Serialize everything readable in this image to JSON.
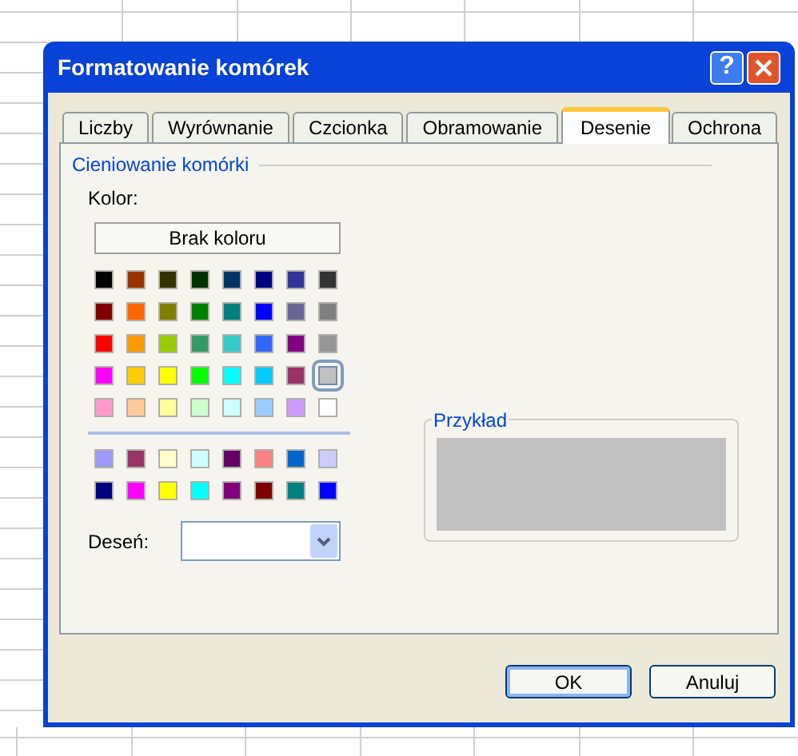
{
  "window": {
    "title": "Formatowanie komórek",
    "help_button": "?"
  },
  "tabs": [
    {
      "label": "Liczby",
      "selected": false
    },
    {
      "label": "Wyrównanie",
      "selected": false
    },
    {
      "label": "Czcionka",
      "selected": false
    },
    {
      "label": "Obramowanie",
      "selected": false
    },
    {
      "label": "Desenie",
      "selected": true
    },
    {
      "label": "Ochrona",
      "selected": false
    }
  ],
  "shading": {
    "title": "Cieniowanie komórki",
    "color_label": "Kolor:",
    "no_color_button": "Brak koloru",
    "palette": [
      [
        {
          "color": "#000000",
          "selected": false
        },
        {
          "color": "#993300",
          "selected": false
        },
        {
          "color": "#333300",
          "selected": false
        },
        {
          "color": "#003300",
          "selected": false
        },
        {
          "color": "#003366",
          "selected": false
        },
        {
          "color": "#000080",
          "selected": false
        },
        {
          "color": "#333399",
          "selected": false
        },
        {
          "color": "#333333",
          "selected": false
        }
      ],
      [
        {
          "color": "#800000",
          "selected": false
        },
        {
          "color": "#ff6600",
          "selected": false
        },
        {
          "color": "#808000",
          "selected": false
        },
        {
          "color": "#008000",
          "selected": false
        },
        {
          "color": "#008080",
          "selected": false
        },
        {
          "color": "#0000ff",
          "selected": false
        },
        {
          "color": "#666699",
          "selected": false
        },
        {
          "color": "#808080",
          "selected": false
        }
      ],
      [
        {
          "color": "#ff0000",
          "selected": false
        },
        {
          "color": "#ff9900",
          "selected": false
        },
        {
          "color": "#99cc00",
          "selected": false
        },
        {
          "color": "#339966",
          "selected": false
        },
        {
          "color": "#33cccc",
          "selected": false
        },
        {
          "color": "#3366ff",
          "selected": false
        },
        {
          "color": "#800080",
          "selected": false
        },
        {
          "color": "#969696",
          "selected": false
        }
      ],
      [
        {
          "color": "#ff00ff",
          "selected": false
        },
        {
          "color": "#ffcc00",
          "selected": false
        },
        {
          "color": "#ffff00",
          "selected": false
        },
        {
          "color": "#00ff00",
          "selected": false
        },
        {
          "color": "#00ffff",
          "selected": false
        },
        {
          "color": "#00ccff",
          "selected": false
        },
        {
          "color": "#993366",
          "selected": false
        },
        {
          "color": "#c0c0c0",
          "selected": true
        }
      ],
      [
        {
          "color": "#ff99cc",
          "selected": false
        },
        {
          "color": "#ffcc99",
          "selected": false
        },
        {
          "color": "#ffff99",
          "selected": false
        },
        {
          "color": "#ccffcc",
          "selected": false
        },
        {
          "color": "#ccffff",
          "selected": false
        },
        {
          "color": "#99ccff",
          "selected": false
        },
        {
          "color": "#cc99ff",
          "selected": false
        },
        {
          "color": "#ffffff",
          "selected": false
        }
      ]
    ],
    "extra_palette": [
      [
        {
          "color": "#9999ff",
          "selected": false
        },
        {
          "color": "#993366",
          "selected": false
        },
        {
          "color": "#ffffcc",
          "selected": false
        },
        {
          "color": "#ccffff",
          "selected": false
        },
        {
          "color": "#660066",
          "selected": false
        },
        {
          "color": "#ff8080",
          "selected": false
        },
        {
          "color": "#0066cc",
          "selected": false
        },
        {
          "color": "#ccccff",
          "selected": false
        }
      ],
      [
        {
          "color": "#000080",
          "selected": false
        },
        {
          "color": "#ff00ff",
          "selected": false
        },
        {
          "color": "#ffff00",
          "selected": false
        },
        {
          "color": "#00ffff",
          "selected": false
        },
        {
          "color": "#800080",
          "selected": false
        },
        {
          "color": "#800000",
          "selected": false
        },
        {
          "color": "#008080",
          "selected": false
        },
        {
          "color": "#0000ff",
          "selected": false
        }
      ]
    ],
    "pattern_label": "Deseń:",
    "sample_title": "Przykład"
  },
  "buttons": [
    {
      "label": "OK",
      "default": true
    },
    {
      "label": "Anuluj",
      "default": false
    }
  ]
}
